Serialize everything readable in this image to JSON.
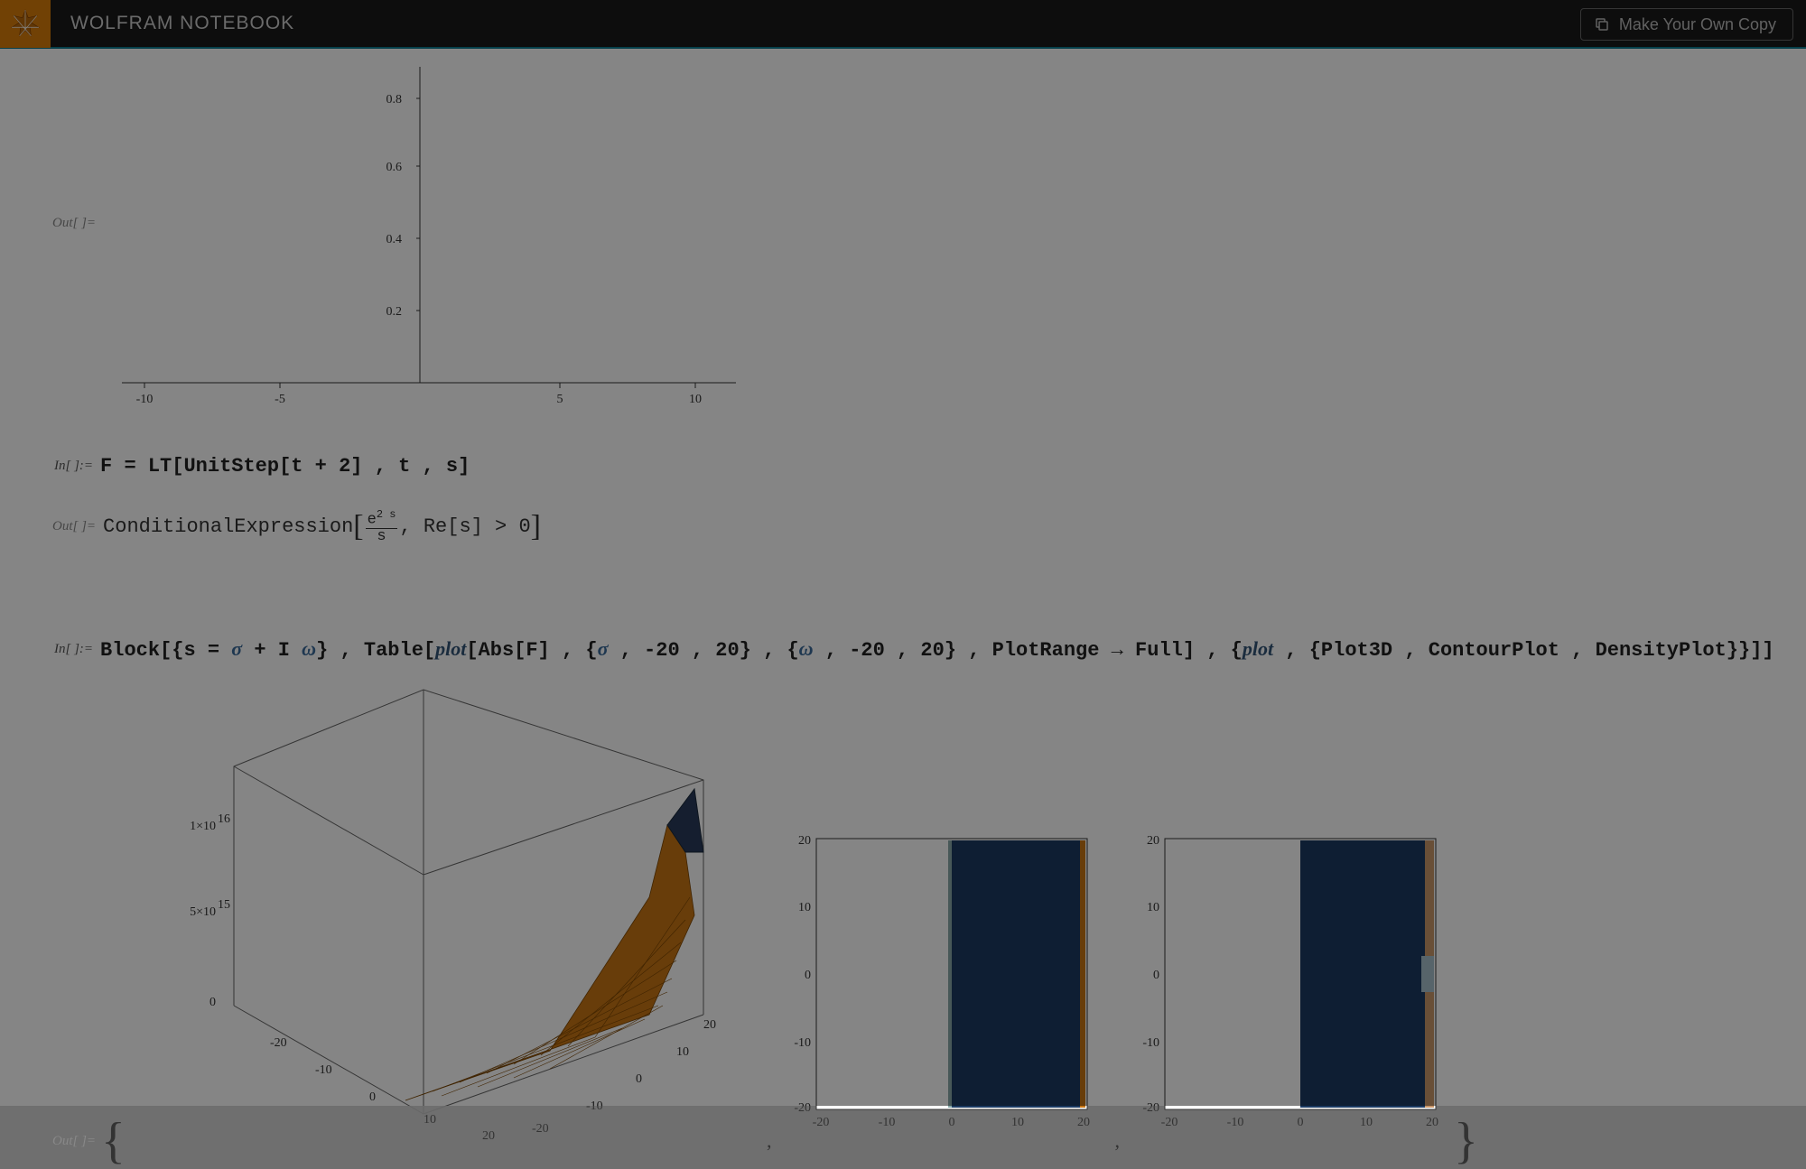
{
  "header": {
    "title": "WOLFRAM NOTEBOOK",
    "copy_button": "Make Your Own Copy"
  },
  "labels": {
    "in": "In[ ]:=",
    "out": "Out[ ]="
  },
  "cell_in_1": "F = LT[UnitStep[t + 2] , t , s]",
  "cell_out_1_prefix": "ConditionalExpression",
  "cell_out_1_frac_num_base": "e",
  "cell_out_1_frac_num_exp": "2 s",
  "cell_out_1_frac_den": "s",
  "cell_out_1_cond": ", Re[s] > 0",
  "cell_in_2_parts": {
    "p1": "Block[{s = ",
    "sigma": "σ",
    "p2": " + I ",
    "omega": "ω",
    "p3": "} , Table[",
    "plot1": "plot",
    "p4": "[Abs[F] , {",
    "sigma2": "σ",
    "p5": " , -20 , 20} , {",
    "omega2": "ω",
    "p6": " , -20 , 20} , PlotRange → Full] , {",
    "plot2": "plot",
    "p7": " , {Plot3D , ContourPlot , DensityPlot}}]]"
  },
  "chart_data": [
    {
      "type": "line",
      "title": "",
      "xlabel": "",
      "ylabel": "",
      "x_ticks": [
        -10,
        -5,
        5,
        10
      ],
      "y_ticks": [
        0.2,
        0.4,
        0.6,
        0.8
      ],
      "xlim": [
        -11,
        11
      ],
      "ylim": [
        0,
        0.9
      ],
      "series": []
    },
    {
      "type": "surface3d",
      "xlabel": "",
      "ylabel": "",
      "zlabel": "",
      "x_ticks": [
        -20,
        -10,
        0,
        10,
        20
      ],
      "y_ticks": [
        -20,
        -10,
        0,
        10,
        20
      ],
      "z_ticks": [
        "0",
        "5×10^15",
        "1×10^16"
      ],
      "xlim": [
        -20,
        20
      ],
      "ylim": [
        -20,
        20
      ],
      "zlim": [
        0,
        1.1e+16
      ],
      "description": "Abs[e^(2s)/s] with s=σ+Iω; large values for σ>0"
    },
    {
      "type": "heatmap",
      "xlabel": "",
      "ylabel": "",
      "x_ticks": [
        -20,
        -10,
        0,
        10,
        20
      ],
      "y_ticks": [
        -20,
        -10,
        0,
        10,
        20
      ],
      "xlim": [
        -20,
        20
      ],
      "ylim": [
        -20,
        20
      ],
      "description": "ContourPlot of Abs[F]; right half plane dark blue, left white"
    },
    {
      "type": "heatmap",
      "xlabel": "",
      "ylabel": "",
      "x_ticks": [
        -20,
        -10,
        0,
        10,
        20
      ],
      "y_ticks": [
        -20,
        -10,
        0,
        10,
        20
      ],
      "xlim": [
        -20,
        20
      ],
      "ylim": [
        -20,
        20
      ],
      "description": "DensityPlot of Abs[F]; right half plane dark blue, left white"
    }
  ]
}
